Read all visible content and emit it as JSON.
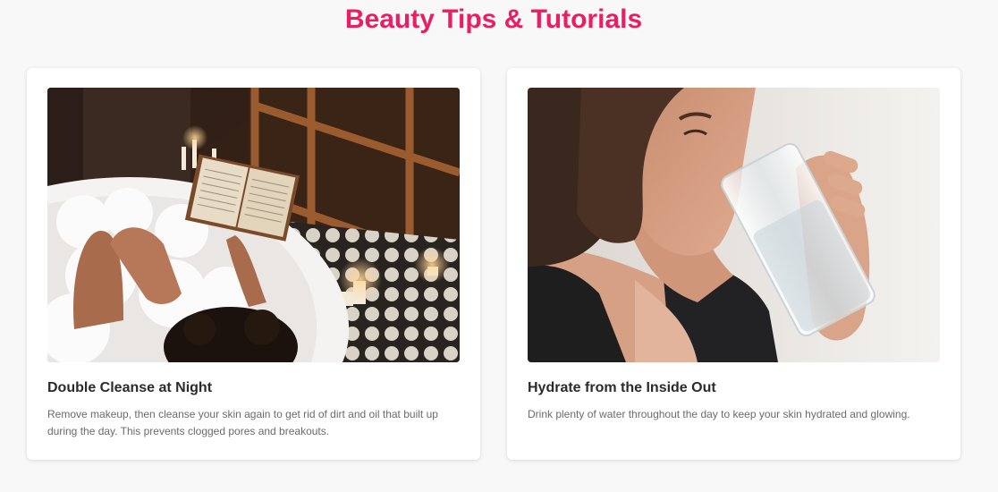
{
  "page": {
    "title": "Beauty Tips & Tutorials",
    "title_color": "#e91e63",
    "background": "#f8f8f9"
  },
  "tips": [
    {
      "title": "Double Cleanse at Night",
      "description": "Remove makeup, then cleanse your skin again to get rid of dirt and oil that built up during the day. This prevents clogged pores and breakouts.",
      "image": "photo of a woman reading a book in a candlelit bubble bath"
    },
    {
      "title": "Hydrate from the Inside Out",
      "description": "Drink plenty of water throughout the day to keep your skin hydrated and glowing.",
      "image": "photo of a woman drinking a glass of water"
    }
  ]
}
